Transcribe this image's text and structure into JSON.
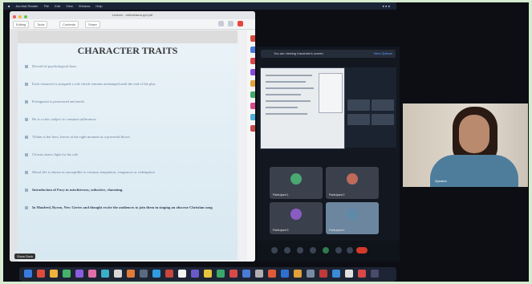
{
  "slide": {
    "title": "CHARACTER TRAITS",
    "bullets": [
      "Devoid of psychological draw",
      "Each character is assigned a role which remains unchanged until the end of the play",
      "Protagonist is persecuted and meek",
      "He is a stoic subject to constant sufferances",
      "Villain is the hero, leaves at the right moment as a powerful blows",
      "Clowns draws fight for his role",
      "Moral life is shown as susceptible to virtuous temptation, vengeance or redemption",
      "Introduction of Fury in mischievous, seductive, charming.",
      "In Manfred, Byron, New Gertes and thought excite the audiences to join them in singing an obscene Christian song"
    ],
    "bold_from_index": 7
  },
  "pdf_window": {
    "title": "Lecture - melodrama-ppt.pdf",
    "toolbar_tabs": [
      "Editing",
      "Tools",
      "Contents",
      "Share"
    ]
  },
  "tooltip": "Show Dock",
  "zoom": {
    "header_text": "You are viewing Kaushaln's screen",
    "view_button": "View Options"
  },
  "participants": [
    {
      "name": "Participant 1",
      "avatar_color": "#4aa872"
    },
    {
      "name": "Participant 2",
      "avatar_color": "#c06a5a"
    },
    {
      "name": "Participant 3",
      "avatar_color": "#8a5cc2"
    },
    {
      "name": "Participant 4",
      "avatar_color": "#5d8aa8"
    }
  ],
  "camera": {
    "name": "Speaker"
  },
  "colors": {
    "slide_bg": "#e5f0f6",
    "bullet_text": "#6b7f9a",
    "zoom_bg": "#121720",
    "end_button": "#d33a2c",
    "background": "#d6ebd0"
  }
}
